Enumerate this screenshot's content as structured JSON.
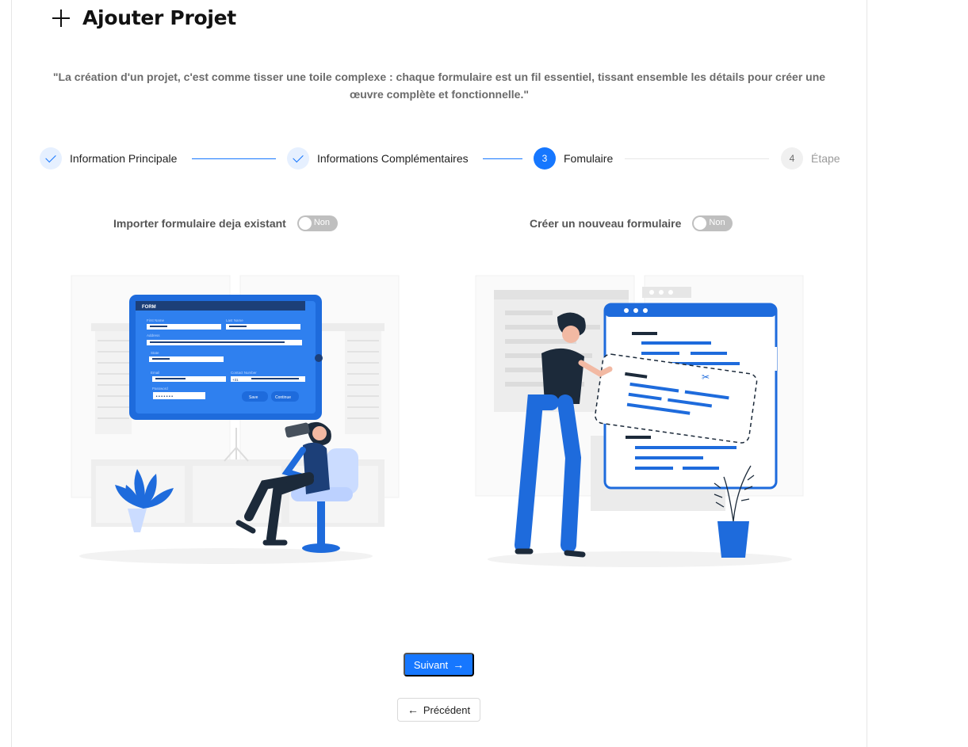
{
  "header": {
    "title": "Ajouter Projet"
  },
  "quote": "\"La création d'un projet, c'est comme tisser une toile complexe : chaque formulaire est un fil essentiel, tissant ensemble les détails pour créer une œuvre complète et fonctionnelle.\"",
  "stepper": {
    "steps": [
      {
        "label": "Information Principale",
        "status": "done"
      },
      {
        "label": "Informations Complémentaires",
        "status": "done"
      },
      {
        "number": "3",
        "label": "Fomulaire",
        "status": "active"
      },
      {
        "number": "4",
        "label": "Étape",
        "status": "wait"
      }
    ]
  },
  "options": {
    "import": {
      "label": "Importer formulaire deja existant",
      "switch_text": "Non",
      "checked": false
    },
    "create": {
      "label": "Créer un nouveau formulaire",
      "switch_text": "Non",
      "checked": false
    }
  },
  "form_illustration": {
    "header": "FORM",
    "first_name": "First Name",
    "last_name": "Last Name",
    "address": "Address",
    "state": "State",
    "email": "Email",
    "contact": "Contact Number",
    "country_code": "+31",
    "password": "Password",
    "password_mask": "•••••••",
    "save": "Save",
    "continue": "Continue"
  },
  "buttons": {
    "next": "Suivant",
    "previous": "Précédent"
  },
  "colors": {
    "primary": "#1677ff",
    "switch_off": "#bfbfbf"
  }
}
